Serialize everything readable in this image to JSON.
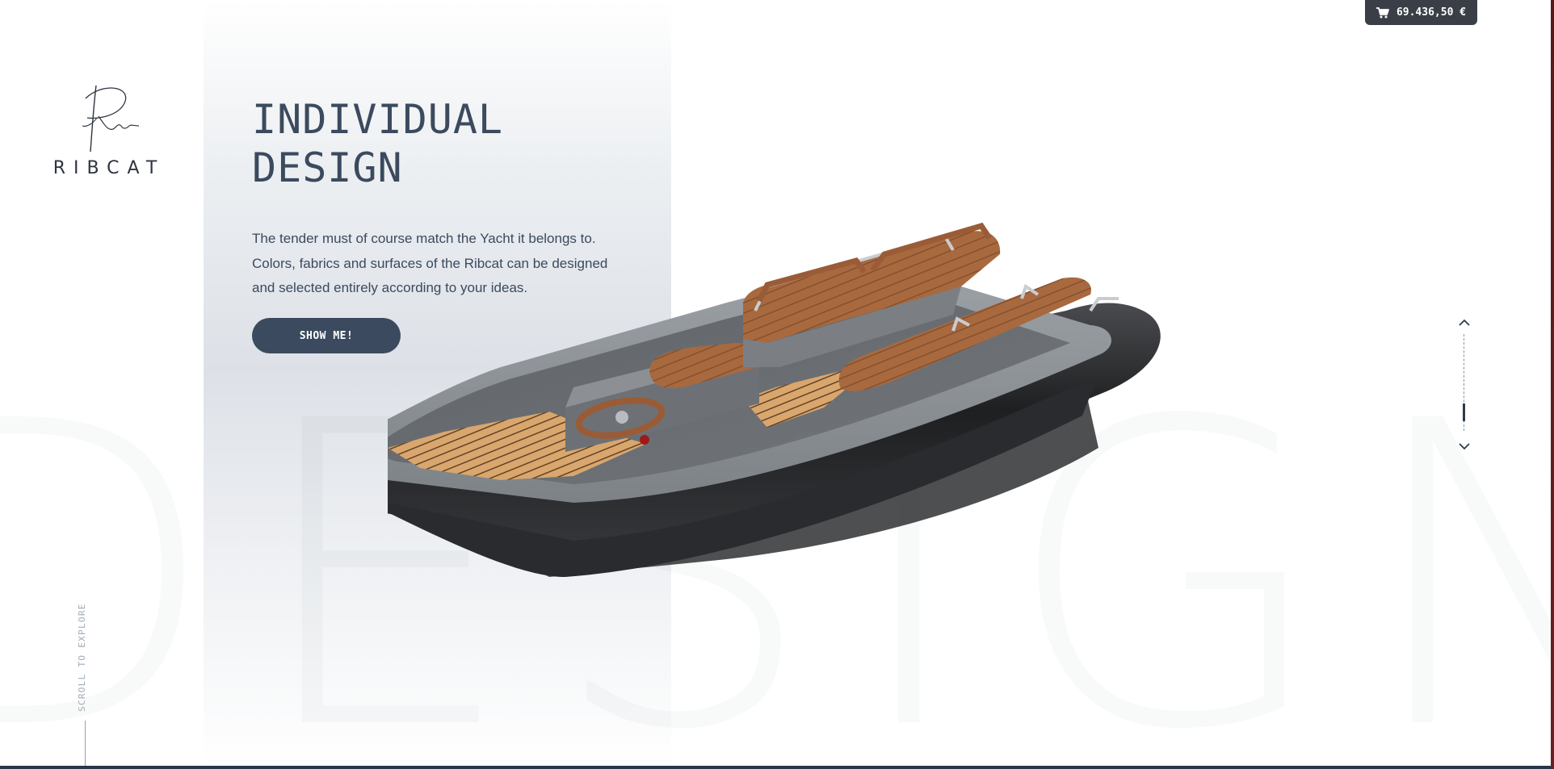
{
  "brand": {
    "name": "RIBCAT"
  },
  "hero": {
    "title_line1": "INDIVIDUAL",
    "title_line2": "DESIGN",
    "body": "The tender must of course match the Yacht it belongs to. Colors, fabrics and surfaces of the Ribcat can be designed and selected entirely according to your ideas.",
    "cta_label": "SHOW ME!"
  },
  "background_word": "DESIGN",
  "cart": {
    "icon": "cart-icon",
    "total": "69.436,50 €"
  },
  "slide_nav": {
    "up_icon": "chevron-up-icon",
    "down_icon": "chevron-down-icon"
  },
  "scroll_hint": {
    "label": "SCROLL TO EXPLORE"
  },
  "colors": {
    "accent": "#3b4a5e",
    "cart_bg": "#3a3f47",
    "hull": "#2b2c2e",
    "deck": "#8d9297",
    "teak": "#d7a56c",
    "leather": "#a86a43"
  }
}
